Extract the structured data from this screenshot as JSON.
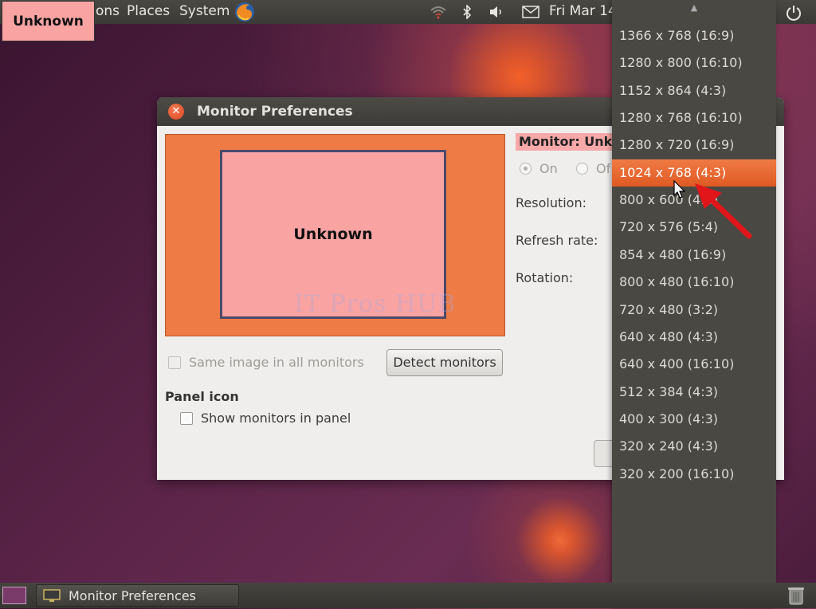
{
  "top_panel": {
    "badge": "Unknown",
    "menu_applications_partial": "ons",
    "menu_places": "Places",
    "menu_system": "System",
    "clock_partial": "Fri Mar 14"
  },
  "dialog": {
    "title": "Monitor Preferences",
    "monitor_preview_label": "Unknown",
    "watermark": "IT Pros HUB",
    "monitor_label": "Monitor: Unknown",
    "on_label": "On",
    "off_label_partial": "Of",
    "resolution_label": "Resolution:",
    "refresh_label": "Refresh rate:",
    "rotation_label": "Rotation:",
    "same_image_label": "Same image in all monitors",
    "detect_button": "Detect monitors",
    "panel_icon_heading": "Panel icon",
    "show_monitors_label": "Show monitors in panel"
  },
  "resolution_menu": {
    "selected_index": 5,
    "items": [
      "1366 x 768 (16:9)",
      "1280 x 800 (16:10)",
      "1152 x 864 (4:3)",
      "1280 x 768 (16:10)",
      "1280 x 720 (16:9)",
      "1024 x 768 (4:3)",
      "800 x 600 (4:3)",
      "720 x 576 (5:4)",
      "854 x 480 (16:9)",
      "800 x 480 (16:10)",
      "720 x 480 (3:2)",
      "640 x 480 (4:3)",
      "640 x 400 (16:10)",
      "512 x 384 (4:3)",
      "400 x 300 (4:3)",
      "320 x 240 (4:3)",
      "320 x 200 (16:10)"
    ]
  },
  "bottom_panel": {
    "task_label": "Monitor Preferences"
  },
  "colors": {
    "accent": "#e8642c",
    "monitor_pink": "#f9a3a3",
    "panel_dark": "#3c3b37"
  }
}
